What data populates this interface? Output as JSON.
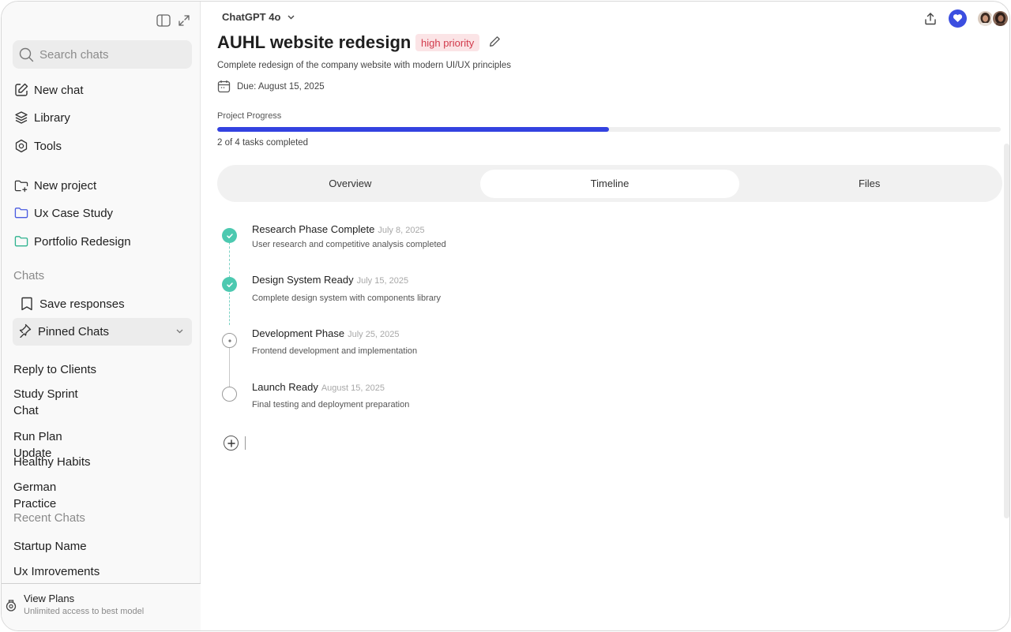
{
  "sidebar": {
    "search_placeholder": "Search chats",
    "nav": {
      "new_chat": "New chat",
      "library": "Library",
      "tools": "Tools",
      "new_project": "New project",
      "ux_case_study": "Ux Case Study",
      "portfolio_redesign": "Portfolio Redesign"
    },
    "chats_heading": "Chats",
    "save_responses": "Save responses",
    "pinned_chats": "Pinned Chats",
    "chats": [
      "Reply to Clients",
      "Study Sprint Chat",
      "Run Plan Update",
      "Healthy Habits",
      "German Practice"
    ],
    "recent_heading": "Recent Chats",
    "recent": [
      "Startup Name",
      "Ux Imrovements"
    ],
    "footer": {
      "title": "View Plans",
      "subtitle": "Unlimited access to best model"
    },
    "colors": {
      "ux_folder": "#4a5be0",
      "portfolio_folder": "#2fb38f"
    }
  },
  "header": {
    "model": "ChatGPT 4o"
  },
  "project": {
    "title": "AUHL website redesign",
    "priority": "high priority",
    "description": "Complete redesign of the company website with modern UI/UX principles",
    "due": "Due: August 15, 2025",
    "progress_label": "Project Progress",
    "progress_fraction": 0.5,
    "progress_text": "2 of 4 tasks completed",
    "colors": {
      "progress": "#3342e0",
      "done": "#4cc9b0",
      "priority_bg": "#fbe4e6",
      "priority_text": "#d23a4b"
    }
  },
  "tabs": [
    "Overview",
    "Timeline",
    "Files"
  ],
  "active_tab": "Timeline",
  "timeline": [
    {
      "title": "Research Phase Complete",
      "date": "July 8, 2025",
      "desc": "User research and competitive analysis completed",
      "status": "done"
    },
    {
      "title": "Design System Ready",
      "date": "July 15, 2025",
      "desc": "Complete design system with components library",
      "status": "done"
    },
    {
      "title": "Development Phase",
      "date": "July 25, 2025",
      "desc": "Frontend development and implementation",
      "status": "in-progress"
    },
    {
      "title": "Launch Ready",
      "date": "August 15, 2025",
      "desc": "Final testing and deployment preparation",
      "status": "todo"
    }
  ]
}
